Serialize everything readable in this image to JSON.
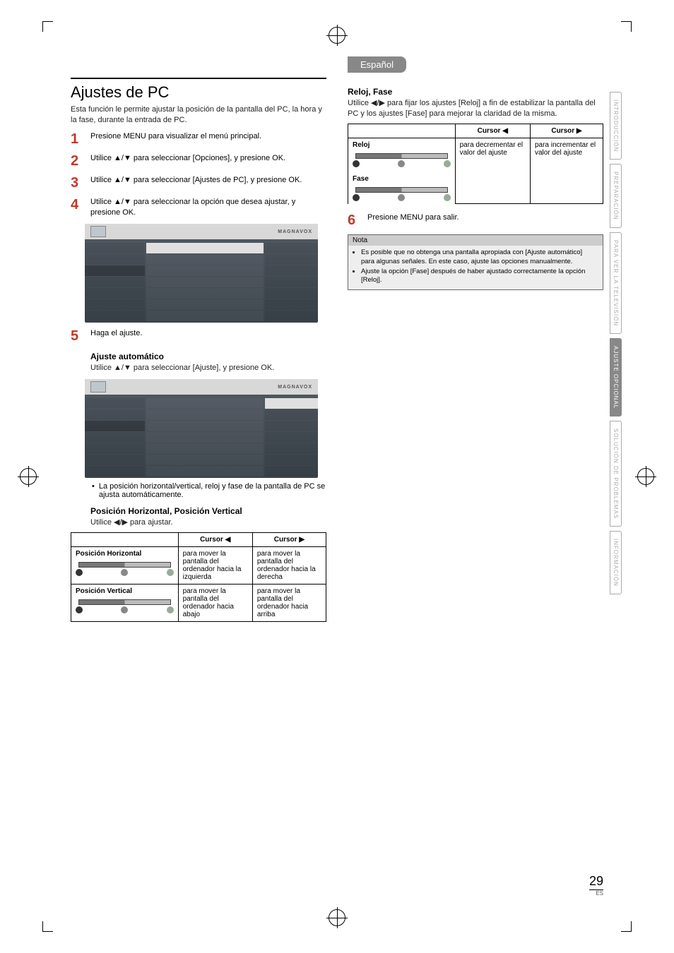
{
  "language_tab": "Español",
  "page_title": "Ajustes de PC",
  "intro": "Esta función le permite ajustar la posición de la pantalla del PC, la hora y la fase, durante la entrada de PC.",
  "steps": {
    "s1": "Presione MENU para visualizar el menú principal.",
    "s2": "Utilice ▲/▼ para seleccionar [Opciones], y presione OK.",
    "s3": "Utilice ▲/▼ para seleccionar [Ajustes de PC], y presione OK.",
    "s4": "Utilice ▲/▼ para seleccionar la opción que desea ajustar, y presione OK.",
    "s5": "Haga el ajuste.",
    "s6": "Presione MENU para salir."
  },
  "screenshot_logo": "MAGNAVOX",
  "auto_adjust_title": "Ajuste automático",
  "auto_adjust_text": "Utilice ▲/▼ para seleccionar [Ajuste], y presione OK.",
  "auto_adjust_bullet": "La posición horizontal/vertical, reloj y fase de la pantalla de PC se ajusta automáticamente.",
  "pos_title": "Posición Horizontal, Posición Vertical",
  "pos_text": "Utilice ◀/▶ para ajustar.",
  "cursor_left": "Cursor ◀",
  "cursor_right": "Cursor ▶",
  "pos_h_label": "Posición Horizontal",
  "pos_h_left": "para mover la pantalla del ordenador hacia la izquierda",
  "pos_h_right": "para mover la pantalla del ordenador hacia la derecha",
  "pos_v_label": "Posición Vertical",
  "pos_v_left": "para mover la pantalla del ordenador hacia abajo",
  "pos_v_right": "para mover la pantalla del ordenador hacia arriba",
  "reloj_title": "Reloj, Fase",
  "reloj_text": "Utilice ◀/▶ para fijar los ajustes [Reloj] a fin de estabilizar la pantalla del PC y los ajustes [Fase] para mejorar la claridad de la misma.",
  "reloj_label": "Reloj",
  "fase_label": "Fase",
  "reloj_left": "para decrementar el valor del ajuste",
  "reloj_right": "para incrementar el valor del ajuste",
  "nota_title": "Nota",
  "nota_1": "Es posible que no obtenga una pantalla apropiada con [Ajuste automático] para algunas señales. En este caso, ajuste las opciones manualmente.",
  "nota_2": "Ajuste la opción [Fase] después de haber ajustado correctamente la opción [Reloj].",
  "side_tabs": {
    "t1": "INTRODUCCIÓN",
    "t2": "PREPARACIÓN",
    "t3": "PARA VER LA TELEVISIÓN",
    "t4": "AJUSTE OPCIONAL",
    "t5": "SOLUCIÓN DE PROBLEMAS",
    "t6": "INFORMACIÓN"
  },
  "page_number": "29",
  "page_lang": "ES"
}
